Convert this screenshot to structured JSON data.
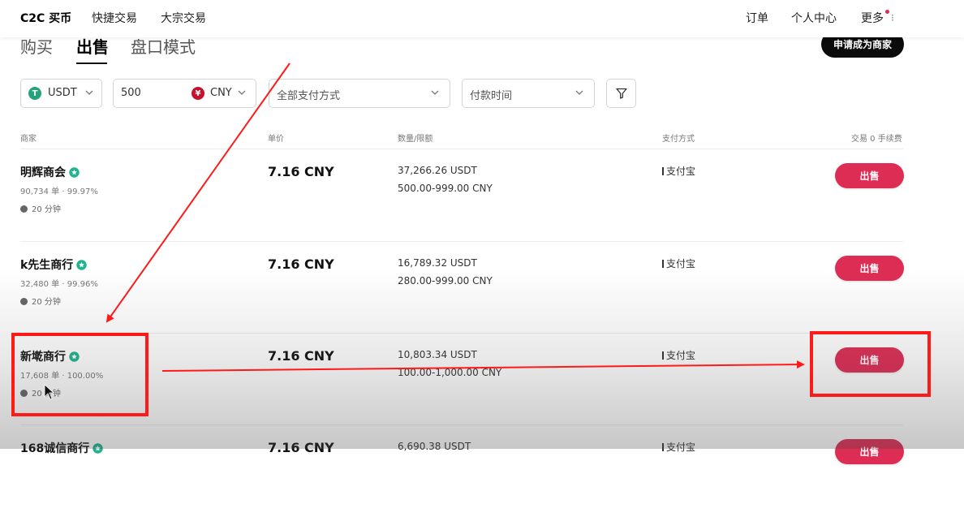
{
  "nav": {
    "brand": "C2C 买币",
    "links": [
      "快捷交易",
      "大宗交易"
    ],
    "right": [
      "订单",
      "个人中心",
      "更多"
    ]
  },
  "tabs": [
    "购买",
    "出售",
    "盘口模式"
  ],
  "active_tab": "出售",
  "merchant_button": "申请成为商家",
  "filters": {
    "coin": "USDT",
    "amount": "500",
    "currency": "CNY",
    "payment": "全部支付方式",
    "time": "付款时间"
  },
  "headers": {
    "merchant": "商家",
    "price": "单价",
    "quantity": "数量/限额",
    "payment": "支付方式",
    "fee": "交易 0 手续费"
  },
  "rows": [
    {
      "name": "明辉商会",
      "stats": "90,734 单 · 99.97%",
      "time": "20 分钟",
      "price": "7.16 CNY",
      "quantity": "37,266.26 USDT",
      "limit": "500.00-999.00 CNY",
      "payment": "支付宝",
      "action": "出售"
    },
    {
      "name": "k先生商行",
      "stats": "32,480 单 · 99.96%",
      "time": "20 分钟",
      "price": "7.16 CNY",
      "quantity": "16,789.32 USDT",
      "limit": "280.00-999.00 CNY",
      "payment": "支付宝",
      "action": "出售"
    },
    {
      "name": "新墘商行",
      "stats": "17,608 单 · 100.00%",
      "time": "20 分钟",
      "price": "7.16 CNY",
      "quantity": "10,803.34 USDT",
      "limit": "100.00-1,000.00 CNY",
      "payment": "支付宝",
      "action": "出售"
    },
    {
      "name": "168诚信商行",
      "stats": "",
      "time": "",
      "price": "7.16 CNY",
      "quantity": "6,690.38 USDT",
      "limit": "",
      "payment": "支付宝",
      "action": "出售"
    }
  ],
  "colors": {
    "sell_button": "#dd2d55",
    "annotation": "#ff1a1a",
    "usdt": "#26a17b",
    "cny": "#c8102e"
  },
  "icons": [
    "usdt-coin-icon",
    "cny-coin-icon",
    "chevron-down-icon",
    "filter-icon",
    "verified-badge-icon",
    "clock-icon",
    "cursor-icon"
  ]
}
